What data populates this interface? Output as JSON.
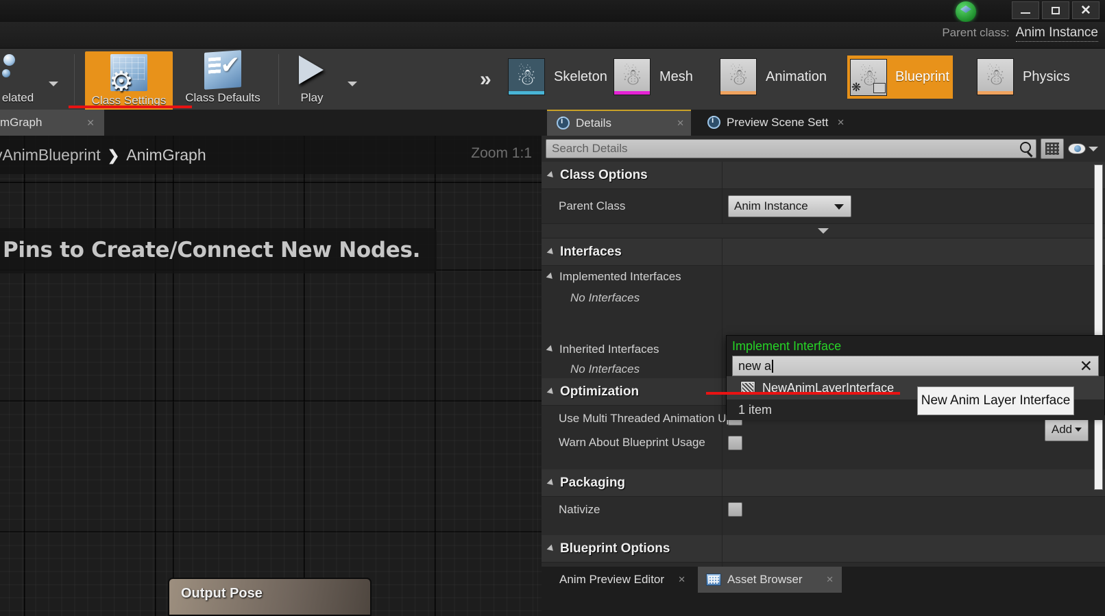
{
  "window": {
    "minimize_label": "–",
    "maximize_label": "□",
    "close_label": "✕",
    "logo_icon": "unreal-engine-logo-icon"
  },
  "parent_class_strip": {
    "label": "Parent class:",
    "value": "Anim Instance"
  },
  "toolbar": {
    "items": [
      {
        "label": "elated",
        "icon": "find-related-icon",
        "has_dropdown": true,
        "active": false
      },
      {
        "label": "Class Settings",
        "icon": "class-settings-icon",
        "has_dropdown": false,
        "active": true
      },
      {
        "label": "Class Defaults",
        "icon": "class-defaults-icon",
        "has_dropdown": false,
        "active": false
      },
      {
        "label": "Play",
        "icon": "play-icon",
        "has_dropdown": true,
        "active": false
      }
    ],
    "overflow_icon": "double-chevron-right-icon",
    "modes": [
      {
        "label": "Skeleton",
        "icon": "skeleton-thumbnail",
        "accent": "#49b4d6",
        "has_dropdown": false,
        "active": false
      },
      {
        "label": "Mesh",
        "icon": "mesh-thumbnail",
        "accent": "#e522d4",
        "has_dropdown": true,
        "active": false
      },
      {
        "label": "Animation",
        "icon": "animation-thumbnail",
        "accent": "#f0a35e",
        "has_dropdown": true,
        "active": false
      },
      {
        "label": "Blueprint",
        "icon": "blueprint-thumbnail",
        "accent": "#f0a35e",
        "has_dropdown": true,
        "active": true
      },
      {
        "label": "Physics",
        "icon": "physics-thumbnail",
        "accent": "#f0a35e",
        "has_dropdown": false,
        "active": false
      }
    ]
  },
  "graph": {
    "tab_label": "mGraph",
    "tab_close": "✕",
    "breadcrumb_root": "vAnimBlueprint",
    "breadcrumb_separator": "❯",
    "breadcrumb_current": "AnimGraph",
    "zoom_label": "Zoom 1:1",
    "hint_text": "Pins to Create/Connect New Nodes.",
    "node_title": "Output Pose"
  },
  "details": {
    "tabs": [
      {
        "label": "Details",
        "icon": "details-info-icon",
        "close": "✕",
        "selected": true
      },
      {
        "label": "Preview Scene Sett",
        "icon": "preview-scene-info-icon",
        "close": "✕",
        "selected": false
      }
    ],
    "search_placeholder": "Search Details",
    "search_icon": "search-magnifier-icon",
    "grid_view_icon": "grid-view-icon",
    "visibility_icon": "eye-visibility-icon",
    "visibility_caret_icon": "chevron-down-icon",
    "categories": [
      {
        "name": "Class Options",
        "rows": [
          {
            "label": "Parent Class",
            "type": "combo",
            "value": "Anim Instance"
          }
        ]
      },
      {
        "name": "Interfaces",
        "rows": [
          {
            "label": "Implemented Interfaces",
            "type": "subheader"
          },
          {
            "label": "No Interfaces",
            "type": "empty"
          },
          {
            "label": "Inherited Interfaces",
            "type": "subheader"
          },
          {
            "label": "No Interfaces",
            "type": "empty"
          }
        ]
      },
      {
        "name": "Optimization",
        "rows": [
          {
            "label": "Use Multi Threaded Animation Upd",
            "type": "checkbox",
            "checked": false
          },
          {
            "label": "Warn About Blueprint Usage",
            "type": "checkbox",
            "checked": false
          }
        ]
      },
      {
        "name": "Packaging",
        "rows": [
          {
            "label": "Nativize",
            "type": "checkbox",
            "checked": false
          }
        ]
      },
      {
        "name": "Blueprint Options",
        "rows": []
      }
    ],
    "add_button_label": "Add",
    "add_button_caret_icon": "chevron-down-icon"
  },
  "interface_popup": {
    "title": "Implement Interface",
    "search_value": "new a",
    "clear_icon": "✕",
    "result": {
      "label": "NewAnimLayerInterface",
      "icon": "interface-asset-icon"
    },
    "count_label": "1 item"
  },
  "tooltip": {
    "text": "New Anim Layer Interface"
  },
  "bottom_tabs": [
    {
      "label": "Anim Preview Editor",
      "close": "✕",
      "icon": null,
      "selected": false
    },
    {
      "label": "Asset Browser",
      "close": "✕",
      "icon": "asset-browser-icon",
      "selected": true
    }
  ],
  "colors": {
    "accent_orange": "#e8921a",
    "annotation_red": "#e81313",
    "popup_title_green": "#26d426"
  }
}
